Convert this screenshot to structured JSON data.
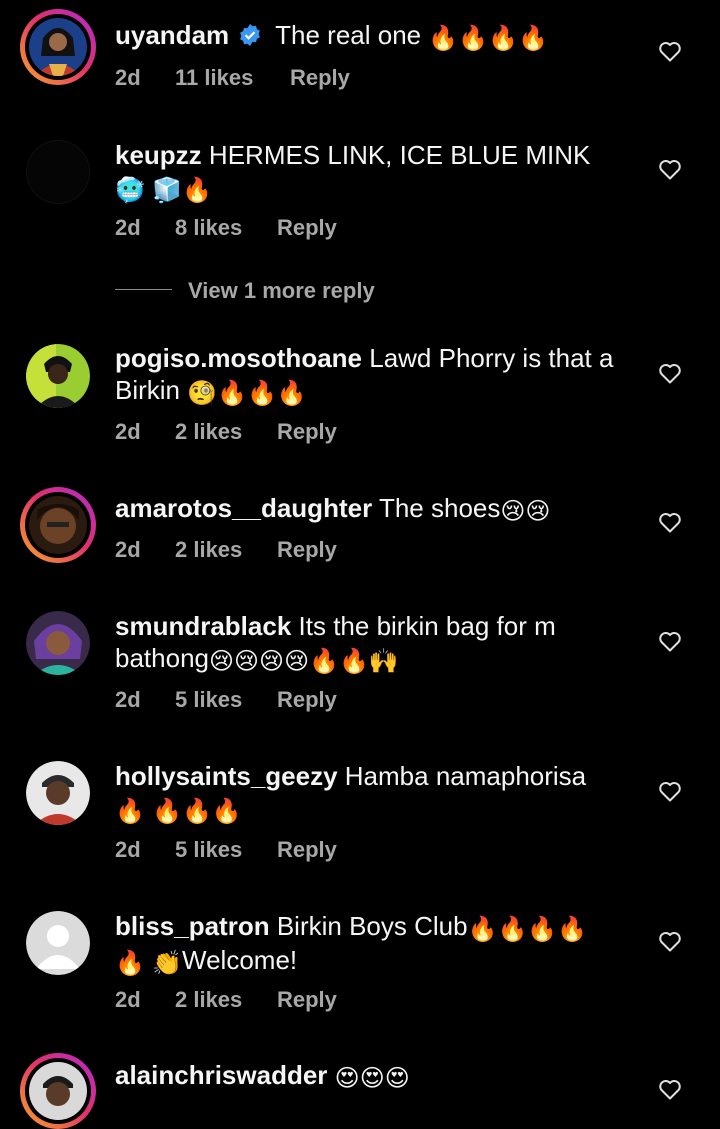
{
  "theme": {
    "background": "#000000",
    "meta_color": "#a8a8a8",
    "verified_color": "#3897f0"
  },
  "comments": [
    {
      "username": "uyandam",
      "verified": true,
      "text": "The real one",
      "emojis": [
        "fire",
        "fire",
        "fire",
        "fire"
      ],
      "time": "2d",
      "likes": "11 likes",
      "reply": "Reply"
    },
    {
      "username": "keupzz",
      "text": "HERMES LINK, ICE BLUE MINK",
      "emojis": [
        "cold-face",
        "ice-cube",
        "fire"
      ],
      "time": "2d",
      "likes": "8 likes",
      "reply": "Reply",
      "view_more": "View 1 more reply"
    },
    {
      "username": "pogiso.mosothoane",
      "text": "Lawd Phorry is that a Birkin",
      "emojis": [
        "monocle-face",
        "fire",
        "fire",
        "fire"
      ],
      "time": "2d",
      "likes": "2 likes",
      "reply": "Reply"
    },
    {
      "username": "amarotos__daughter",
      "text": "The shoes",
      "emojis": [
        "crying-face",
        "crying-face"
      ],
      "time": "2d",
      "likes": "2 likes",
      "reply": "Reply"
    },
    {
      "username": "smundrablack",
      "text": "Its the birkin bag for m bathong",
      "emojis": [
        "crying-face",
        "crying-face",
        "crying-face",
        "crying-face",
        "fire",
        "fire",
        "raising-hands"
      ],
      "time": "2d",
      "likes": "5 likes",
      "reply": "Reply"
    },
    {
      "username": "hollysaints_geezy",
      "text": "Hamba namaphorisa",
      "emojis": [
        "fire",
        "fire",
        "fire",
        "fire"
      ],
      "time": "2d",
      "likes": "5 likes",
      "reply": "Reply"
    },
    {
      "username": "bliss_patron",
      "text": "Birkin Boys Club",
      "emojis": [
        "fire",
        "fire",
        "fire",
        "fire",
        "fire",
        "clapping-hands"
      ],
      "text2": "Welcome!",
      "time": "2d",
      "likes": "2 likes",
      "reply": "Reply"
    },
    {
      "username": "alainchriswadder",
      "text": "",
      "emojis": [
        "heart-eyes",
        "heart-eyes",
        "heart-eyes"
      ]
    }
  ]
}
